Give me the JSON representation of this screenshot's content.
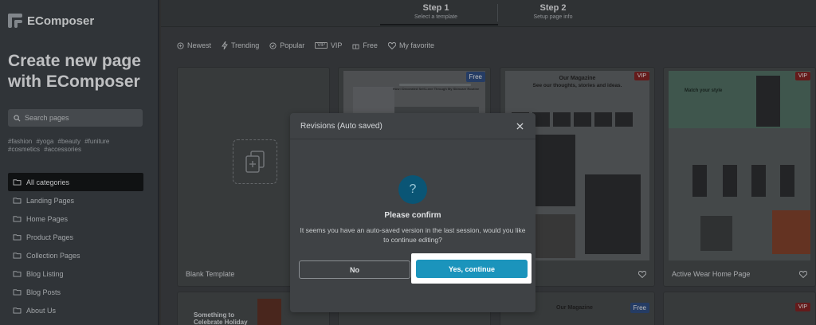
{
  "app": {
    "name": "EComposer"
  },
  "sidebar": {
    "title": "Create new page with EComposer",
    "search_placeholder": "Search pages",
    "tags": [
      "#fashion",
      "#yoga",
      "#beauty",
      "#funiture",
      "#cosmetics",
      "#accessories"
    ],
    "categories": [
      {
        "label": "All categories",
        "active": true
      },
      {
        "label": "Landing Pages"
      },
      {
        "label": "Home Pages"
      },
      {
        "label": "Product Pages"
      },
      {
        "label": "Collection Pages"
      },
      {
        "label": "Blog Listing"
      },
      {
        "label": "Blog Posts"
      },
      {
        "label": "About Us"
      }
    ]
  },
  "steps": [
    {
      "number": "Step 1",
      "label": "Select a template",
      "active": true
    },
    {
      "number": "Step 2",
      "label": "Setup page info"
    }
  ],
  "filters": [
    "Newest",
    "Trending",
    "Popular",
    "VIP",
    "Free",
    "My favorite"
  ],
  "cards": [
    {
      "title": "Blank Template"
    },
    {
      "badge": "Free",
      "thumb_heading": "How I Decorated Self-Love Through My Skincare Routine"
    },
    {
      "badge": "VIP",
      "thumb_heading": "Our Magazine",
      "thumb_sub": "See our thoughts, stories and ideas."
    },
    {
      "badge": "VIP",
      "title": "Active Wear Home Page",
      "thumb_heading": "Match your style"
    }
  ],
  "row2": {
    "card1_text": "Something to Celebrate Holiday",
    "card3_text": "Our Magazine",
    "card3_badge": "Free",
    "card4_badge": "VIP"
  },
  "modal": {
    "title": "Revisions (Auto saved)",
    "confirm_title": "Please confirm",
    "message": "It seems you have an auto-saved version in the last session, would you like to continue editing?",
    "no_label": "No",
    "yes_label": "Yes, continue",
    "icon": "question-mark-icon"
  },
  "colors": {
    "accent": "#1b94bc",
    "highlight": "#ffffff"
  }
}
